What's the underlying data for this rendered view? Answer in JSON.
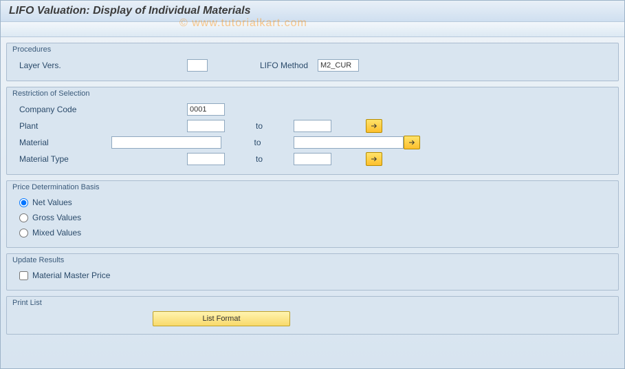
{
  "title": "LIFO Valuation: Display of Individual Materials",
  "watermark": "© www.tutorialkart.com",
  "groups": {
    "procedures": {
      "legend": "Procedures",
      "layer_vers_label": "Layer Vers.",
      "layer_vers_value": "",
      "lifo_method_label": "LIFO Method",
      "lifo_method_value": "M2_CUR"
    },
    "restriction": {
      "legend": "Restriction of Selection",
      "company_code_label": "Company Code",
      "company_code_value": "0001",
      "plant_label": "Plant",
      "plant_from": "",
      "plant_to": "",
      "material_label": "Material",
      "material_from": "",
      "material_to": "",
      "material_type_label": "Material Type",
      "material_type_from": "",
      "material_type_to": "",
      "to_label": "to"
    },
    "price_basis": {
      "legend": "Price Determination Basis",
      "net_label": "Net Values",
      "gross_label": "Gross Values",
      "mixed_label": "Mixed Values",
      "selected": "net"
    },
    "update": {
      "legend": "Update Results",
      "material_master_price_label": "Material Master Price",
      "material_master_price_checked": false
    },
    "print": {
      "legend": "Print List",
      "list_format_label": "List Format"
    }
  }
}
